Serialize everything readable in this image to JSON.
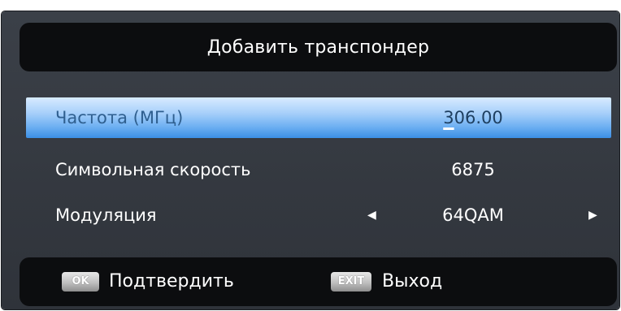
{
  "dialog": {
    "title": "Добавить транспондер"
  },
  "settings": [
    {
      "label": "Частота (МГц)",
      "value_cursor": "3",
      "value_rest": "06.00",
      "selected": true
    },
    {
      "label": "Символьная скорость",
      "value": "6875"
    },
    {
      "label": "Модуляция",
      "value": "64QAM",
      "left_arrow": "◀",
      "right_arrow": "▶"
    }
  ],
  "footer": {
    "ok_key": "OK",
    "ok_label": "Подтвердить",
    "exit_key": "EXIT",
    "exit_label": "Выход"
  },
  "colors": {
    "highlight": "#6eb0f2",
    "panel": "#0c0d0f",
    "background": "#343840"
  }
}
